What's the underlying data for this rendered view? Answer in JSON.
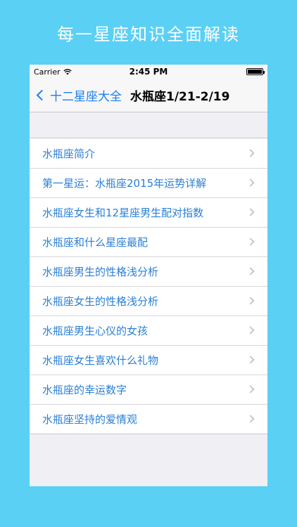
{
  "banner": {
    "title": "每一星座知识全面解读"
  },
  "status": {
    "carrier": "Carrier",
    "time": "2:45 PM"
  },
  "nav": {
    "back_label": "十二星座大全",
    "title": "水瓶座1/21-2/19"
  },
  "list": {
    "items": [
      "水瓶座简介",
      "第一星运：水瓶座2015年运势详解",
      "水瓶座女生和12星座男生配对指数",
      "水瓶座和什么星座最配",
      "水瓶座男生的性格浅分析",
      "水瓶座女生的性格浅分析",
      "水瓶座男生心仪的女孩",
      "水瓶座女生喜欢什么礼物",
      "水瓶座的幸运数字",
      "水瓶座坚持的爱情观"
    ]
  },
  "colors": {
    "background": "#5ad0f5",
    "link": "#2a7fd6",
    "nav_tint": "#1b7ef0"
  },
  "icons": {
    "back": "chevron-left-icon",
    "disclosure": "chevron-right-icon",
    "wifi": "wifi-icon",
    "battery": "battery-icon"
  }
}
